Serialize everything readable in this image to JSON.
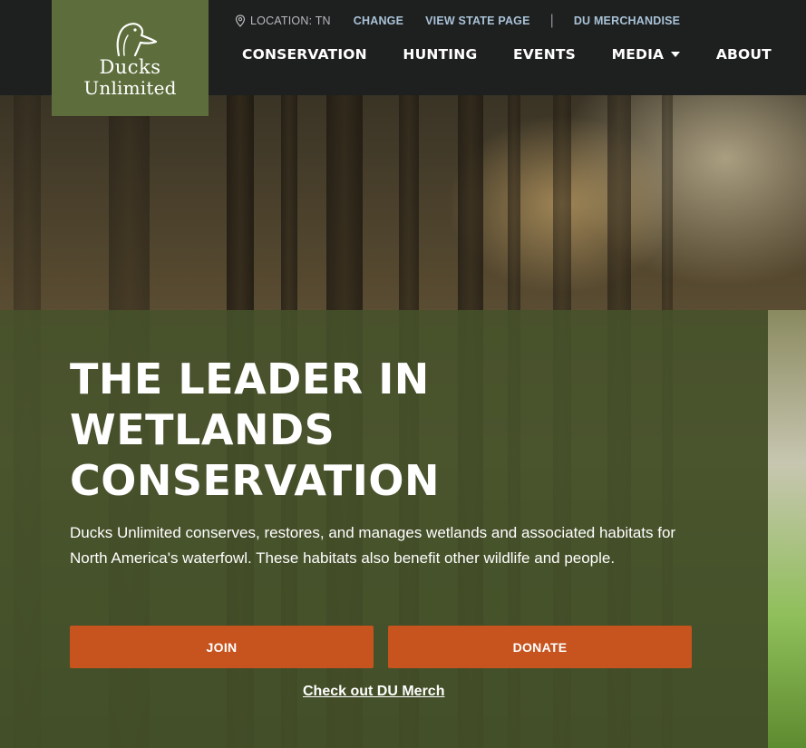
{
  "logo": {
    "line1": "Ducks",
    "line2": "Unlimited"
  },
  "utility": {
    "location": "LOCATION: TN",
    "change": "CHANGE",
    "state_page": "VIEW STATE PAGE",
    "separator": "|",
    "merch": "DU MERCHANDISE"
  },
  "nav": {
    "items": [
      "CONSERVATION",
      "HUNTING",
      "EVENTS",
      "MEDIA",
      "ABOUT"
    ]
  },
  "hero": {
    "headline": "THE LEADER IN WETLANDS CONSERVATION",
    "description": "Ducks Unlimited conserves, restores, and manages wetlands and associated habitats for North America's waterfowl. These habitats also benefit other wildlife and people.",
    "join": "JOIN",
    "donate": "DONATE",
    "merch_link": "Check out DU Merch"
  },
  "colors": {
    "header_bg": "#1e1f1f",
    "logo_bg": "#5d6e3c",
    "panel": "#46522a",
    "button": "#c7541e",
    "util_link": "#a9c3d8"
  }
}
